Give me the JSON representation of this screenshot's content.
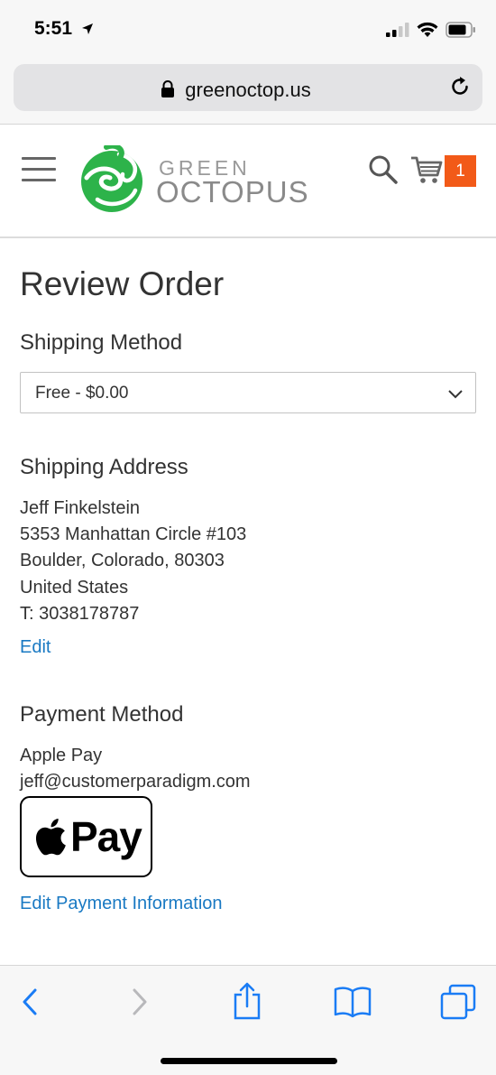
{
  "status_bar": {
    "time": "5:51"
  },
  "browser": {
    "url": "greenoctop.us"
  },
  "site": {
    "logo_line1": "GREEN",
    "logo_line2": "OCTOPUS",
    "cart_count": "1",
    "colors": {
      "cart_badge": "#f25a18",
      "logo_green": "#2db34a",
      "link": "#1979c3"
    }
  },
  "page": {
    "title": "Review Order",
    "shipping_method": {
      "heading": "Shipping Method",
      "selected": "Free - $0.00"
    },
    "shipping_address": {
      "heading": "Shipping Address",
      "lines": [
        "Jeff Finkelstein",
        "5353 Manhattan Circle #103",
        "Boulder, Colorado, 80303",
        "United States",
        "T: 3038178787"
      ],
      "edit_label": "Edit"
    },
    "payment_method": {
      "heading": "Payment Method",
      "method": "Apple Pay",
      "email": "jeff@customerparadigm.com",
      "badge_text": "Pay",
      "edit_label": "Edit Payment Information"
    }
  },
  "toolbar": {
    "icons": [
      "back-icon",
      "forward-icon",
      "share-icon",
      "bookmarks-icon",
      "tabs-icon"
    ]
  }
}
